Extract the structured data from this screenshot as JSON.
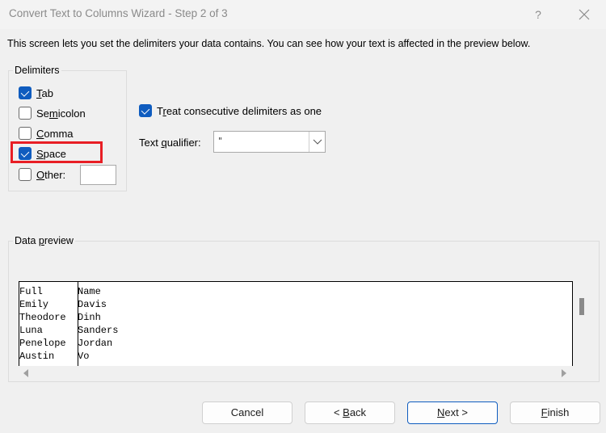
{
  "window": {
    "title": "Convert Text to Columns Wizard - Step 2 of 3",
    "help_label": "?",
    "close_icon": "close-icon"
  },
  "intro_text": "This screen lets you set the delimiters your data contains.  You can see how your text is affected in the preview below.",
  "delimiters": {
    "legend": "Delimiters",
    "items": [
      {
        "label_ul": "T",
        "label_rest": "ab",
        "label_pre": "",
        "checked": true
      },
      {
        "label_pre": "Se",
        "label_ul": "m",
        "label_rest": "icolon",
        "checked": false
      },
      {
        "label_pre": "",
        "label_ul": "C",
        "label_rest": "omma",
        "checked": false
      },
      {
        "label_pre": "",
        "label_ul": "S",
        "label_rest": "pace",
        "checked": true
      },
      {
        "label_pre": "",
        "label_ul": "O",
        "label_rest": "ther:",
        "checked": false
      }
    ],
    "other_value": "",
    "highlight_color": "#e81e25"
  },
  "options": {
    "consecutive": {
      "label_pre": "T",
      "label_ul": "r",
      "label_rest": "eat consecutive delimiters as one",
      "checked": true
    },
    "text_qualifier": {
      "label_pre": "Text ",
      "label_ul": "q",
      "label_rest": "ualifier:",
      "value": "\""
    }
  },
  "preview": {
    "legend_pre": "Data ",
    "legend_ul": "p",
    "legend_rest": "review",
    "rows": [
      [
        "Full",
        "Name"
      ],
      [
        "Emily",
        "Davis"
      ],
      [
        "Theodore",
        "Dinh"
      ],
      [
        "Luna",
        "Sanders"
      ],
      [
        "Penelope",
        "Jordan"
      ],
      [
        "Austin",
        "Vo"
      ]
    ]
  },
  "buttons": {
    "cancel": {
      "pre": "Cancel",
      "ul": "",
      "rest": ""
    },
    "back": {
      "pre": "< ",
      "ul": "B",
      "rest": "ack"
    },
    "next": {
      "pre": "",
      "ul": "N",
      "rest": "ext >"
    },
    "finish": {
      "pre": "",
      "ul": "F",
      "rest": "inish"
    }
  },
  "colors": {
    "accent": "#0f5cbf",
    "background": "#f0f0f0"
  }
}
